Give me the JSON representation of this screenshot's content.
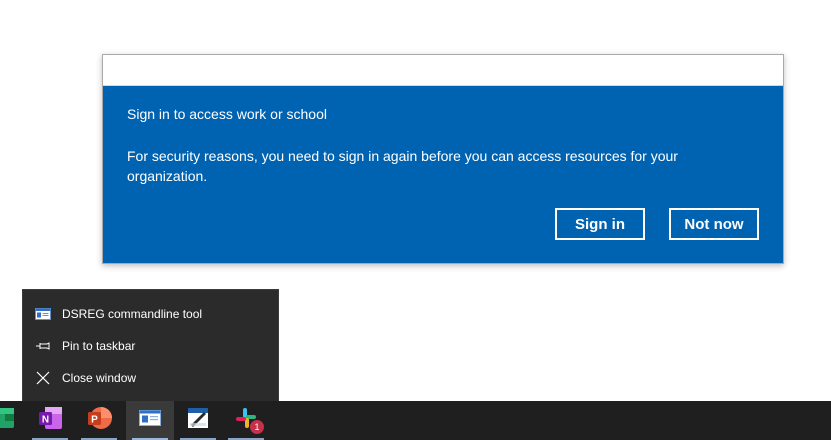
{
  "toast": {
    "heading": "Sign in to access work or school",
    "message": "For security reasons, you need to sign in again before you can access resources for your organization.",
    "sign_in_label": "Sign in",
    "not_now_label": "Not now",
    "accent_color": "#0063b1"
  },
  "jumplist": {
    "items": [
      {
        "label": "DSREG commandline tool",
        "icon": "app-window-icon"
      },
      {
        "label": "Pin to taskbar",
        "icon": "pin-icon"
      },
      {
        "label": "Close window",
        "icon": "close-icon"
      }
    ]
  },
  "taskbar": {
    "apps": [
      {
        "name": "excel",
        "icon": "excel-icon"
      },
      {
        "name": "onenote",
        "icon": "onenote-icon",
        "letter": "N"
      },
      {
        "name": "powerpoint",
        "icon": "powerpoint-icon",
        "letter": "P"
      },
      {
        "name": "dsreg",
        "icon": "app-window-icon",
        "active": true
      },
      {
        "name": "snipping",
        "icon": "snipping-tool-icon"
      },
      {
        "name": "slack",
        "icon": "slack-icon",
        "badge": "1"
      }
    ]
  }
}
